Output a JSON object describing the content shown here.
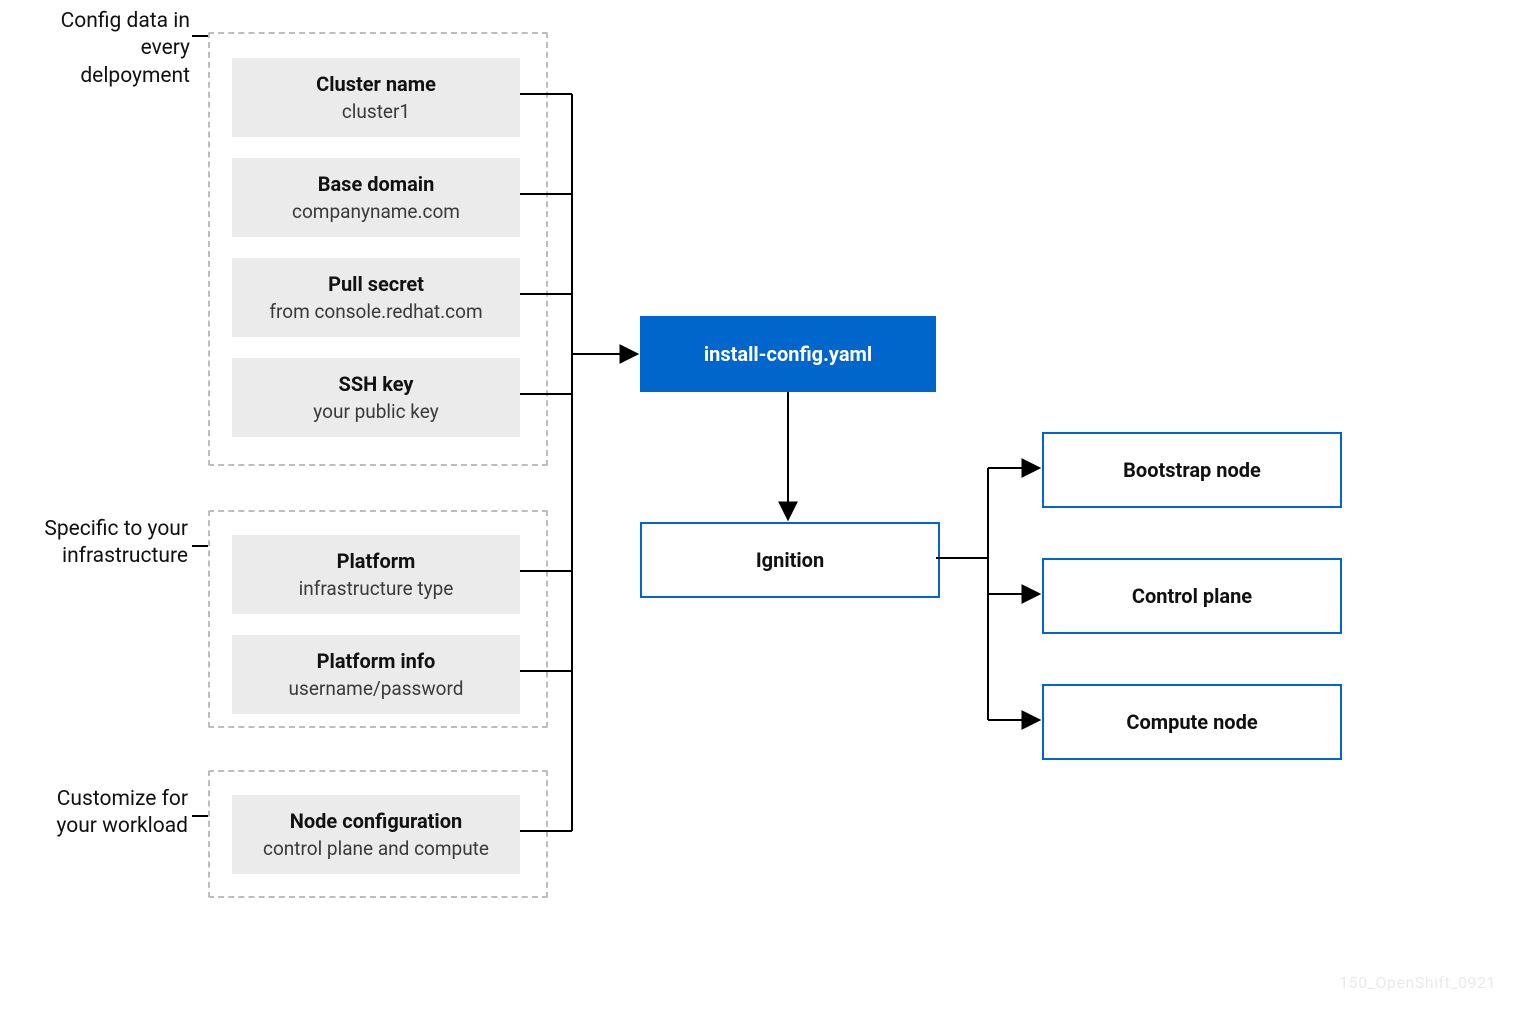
{
  "notes": {
    "config": "Config data in\nevery delpoyment",
    "infra": "Specific to your\ninfrastructure",
    "workload": "Customize for\nyour workload"
  },
  "group1": [
    {
      "title": "Cluster name",
      "sub": "cluster1"
    },
    {
      "title": "Base domain",
      "sub": "companyname.com"
    },
    {
      "title": "Pull secret",
      "sub": "from console.redhat.com"
    },
    {
      "title": "SSH key",
      "sub": "your public key"
    }
  ],
  "group2": [
    {
      "title": "Platform",
      "sub": "infrastructure type"
    },
    {
      "title": "Platform info",
      "sub": "username/password"
    }
  ],
  "group3": [
    {
      "title": "Node configuration",
      "sub": "control plane and compute"
    }
  ],
  "center": {
    "install": "install-config.yaml",
    "ignition": "Ignition"
  },
  "outputs": [
    "Bootstrap node",
    "Control plane",
    "Compute node"
  ],
  "watermark": "150_OpenShift_0921"
}
